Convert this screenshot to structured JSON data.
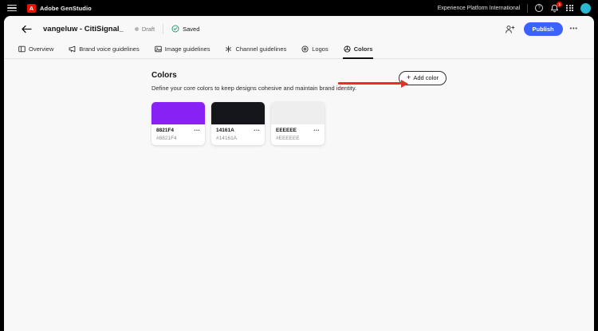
{
  "topbar": {
    "app_name": "Adobe GenStudio",
    "logo_letter": "A",
    "org_name": "Experience Platform International",
    "help_label": "?",
    "notification_badge": "1"
  },
  "toolbar": {
    "title": "vangeluw - CitiSignal_",
    "draft_label": "Draft",
    "saved_label": "Saved",
    "publish_label": "Publish",
    "more_label": "•••"
  },
  "tabs": [
    {
      "label": "Overview",
      "active": false
    },
    {
      "label": "Brand voice guidelines",
      "active": false
    },
    {
      "label": "Image guidelines",
      "active": false
    },
    {
      "label": "Channel guidelines",
      "active": false
    },
    {
      "label": "Logos",
      "active": false
    },
    {
      "label": "Colors",
      "active": true
    }
  ],
  "colors_section": {
    "heading": "Colors",
    "description": "Define your core colors to keep designs cohesive and maintain brand identity.",
    "add_color_plus": "+",
    "add_color_label": "Add color",
    "card_menu_label": "•••",
    "cards": [
      {
        "name": "8821F4",
        "hex": "#8821F4"
      },
      {
        "name": "14161A",
        "hex": "#14161A"
      },
      {
        "name": "EEEEEE",
        "hex": "#EEEEEE"
      }
    ]
  },
  "ui_colors": {
    "accent_blue": "#3b63fb",
    "adobe_red": "#eb1000",
    "badge_red": "#eb1000",
    "avatar_cyan": "#29b7d4",
    "saved_green": "#2d9d78",
    "annotation_red": "#ee2b24"
  }
}
